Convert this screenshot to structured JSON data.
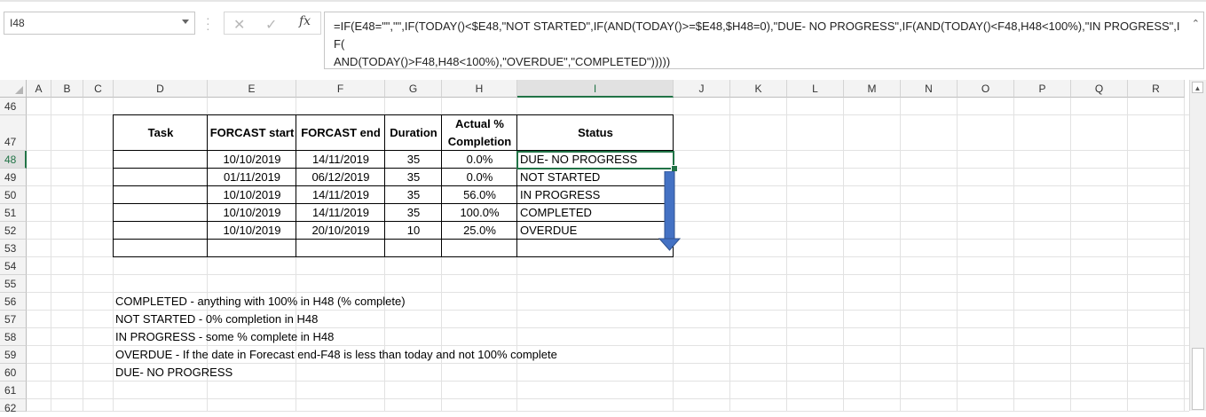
{
  "name_box": {
    "value": "I48"
  },
  "formula_bar": {
    "cancel_icon": "close-icon",
    "enter_icon": "check-icon",
    "fx_label": "fx",
    "formula": "=IF(E48=\"\",\"\",IF(TODAY()<$E48,\"NOT STARTED\",IF(AND(TODAY()>=$E48,$H48=0),\"DUE- NO PROGRESS\",IF(AND(TODAY()<F48,H48<100%),\"IN PROGRESS\",IF(\nAND(TODAY()>F48,H48<100%),\"OVERDUE\",\"COMPLETED\")))))"
  },
  "columns": [
    "A",
    "B",
    "C",
    "D",
    "E",
    "F",
    "G",
    "H",
    "I",
    "J",
    "K",
    "L",
    "M",
    "N",
    "O",
    "P",
    "Q",
    "R"
  ],
  "selected_column": "I",
  "rows": [
    "46",
    "47",
    "48",
    "49",
    "50",
    "51",
    "52",
    "53",
    "54",
    "55",
    "56",
    "57",
    "58",
    "59",
    "60",
    "61",
    "62"
  ],
  "selected_row": "48",
  "table": {
    "headers": {
      "task": "Task",
      "start": "FORCAST start",
      "end": "FORCAST end",
      "duration": "Duration",
      "actual": "Actual % Completion",
      "status": "Status"
    },
    "rows": [
      {
        "task": "",
        "start": "10/10/2019",
        "end": "14/11/2019",
        "duration": "35",
        "actual": "0.0%",
        "status": "DUE- NO PROGRESS"
      },
      {
        "task": "",
        "start": "01/11/2019",
        "end": "06/12/2019",
        "duration": "35",
        "actual": "0.0%",
        "status": "NOT STARTED"
      },
      {
        "task": "",
        "start": "10/10/2019",
        "end": "14/11/2019",
        "duration": "35",
        "actual": "56.0%",
        "status": "IN PROGRESS"
      },
      {
        "task": "",
        "start": "10/10/2019",
        "end": "14/11/2019",
        "duration": "35",
        "actual": "100.0%",
        "status": "COMPLETED"
      },
      {
        "task": "",
        "start": "10/10/2019",
        "end": "20/10/2019",
        "duration": "10",
        "actual": "25.0%",
        "status": "OVERDUE"
      },
      {
        "task": "",
        "start": "",
        "end": "",
        "duration": "",
        "actual": "",
        "status": ""
      }
    ]
  },
  "notes": [
    "COMPLETED - anything with 100% in H48 (% complete)",
    "NOT STARTED - 0% completion in H48",
    "IN PROGRESS - some % complete in H48",
    "OVERDUE - If the date in Forecast end-F48 is less than today and not 100% complete",
    "DUE- NO PROGRESS"
  ],
  "arrow_color": "#4472c4",
  "accent_color": "#217346"
}
